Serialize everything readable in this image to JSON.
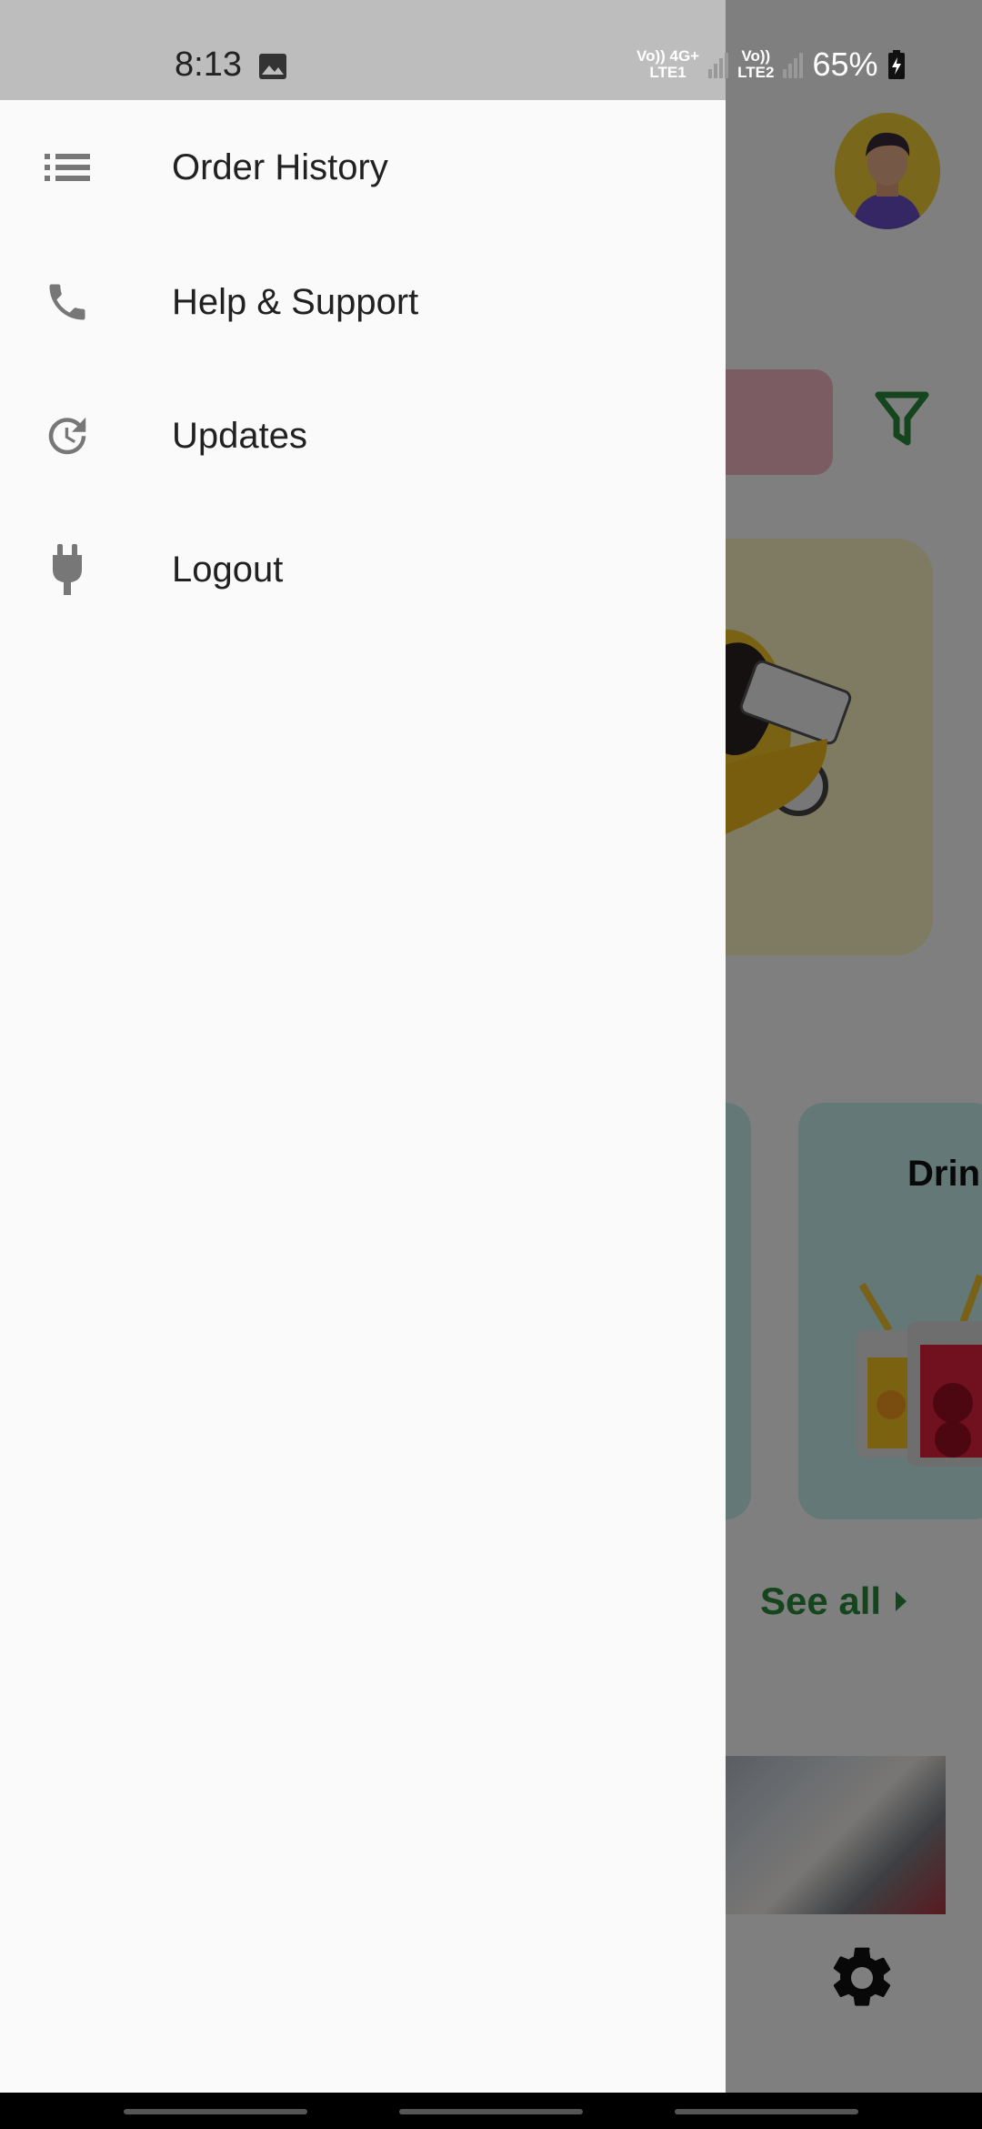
{
  "status_bar": {
    "time": "8:13",
    "net1_top": "Vo)) 4G+",
    "net1_bottom": "LTE1",
    "net2_top": "Vo))",
    "net2_bottom": "LTE2",
    "battery": "65%"
  },
  "drawer": {
    "items": [
      {
        "label": "Order History",
        "icon": "list-icon"
      },
      {
        "label": "Help & Support",
        "icon": "phone-icon"
      },
      {
        "label": "Updates",
        "icon": "update-clock-icon"
      },
      {
        "label": "Logout",
        "icon": "plug-icon"
      }
    ]
  },
  "background": {
    "category_title": "Drink",
    "see_all": "See all"
  },
  "colors": {
    "drawer_bg": "#fafafa",
    "accent_green": "#2a8a3a",
    "status_bar": "#bdbdbd"
  }
}
